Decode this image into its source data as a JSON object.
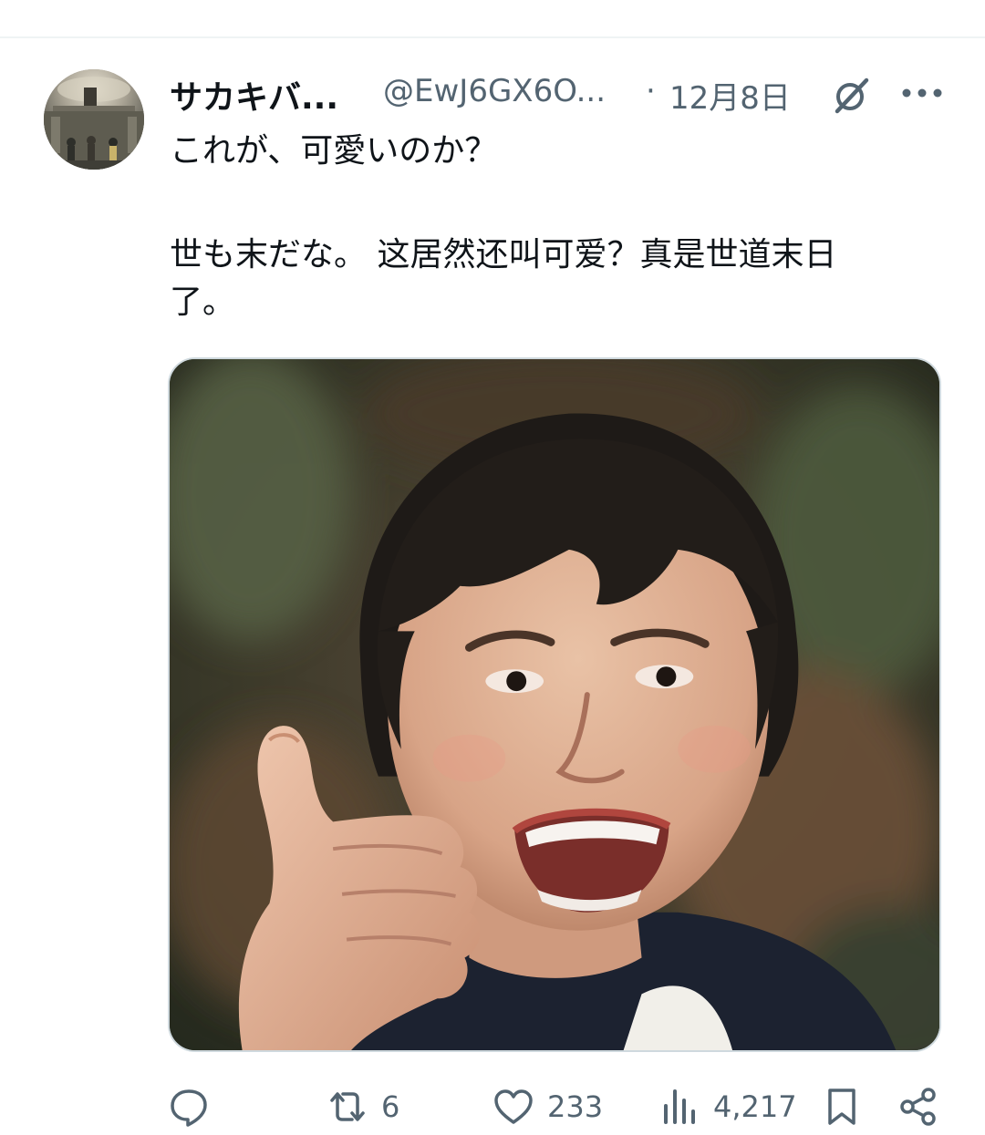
{
  "tweet": {
    "display_name": "サカキバ...",
    "handle": "@EwJ6GX6O...",
    "separator": "·",
    "date": "12月8日",
    "text_line_1": "これが、可愛いのか？",
    "text_line_2": "世も末だな。 这居然还叫可爱？真是世道末日",
    "text_line_3": "了。"
  },
  "actions": {
    "reply_count": "",
    "retweet_count": "6",
    "like_count": "233",
    "views_count": "4,217"
  },
  "icons": {
    "avatar": "avatar-image",
    "grok": "grok-icon",
    "more": "more-dots-icon",
    "reply": "reply-icon",
    "retweet": "retweet-icon",
    "like": "heart-icon",
    "views": "views-bar-chart-icon",
    "bookmark": "bookmark-icon",
    "share": "share-icon"
  },
  "colors": {
    "text_primary": "#0f1419",
    "text_secondary": "#536471",
    "border": "#cfd9de"
  }
}
